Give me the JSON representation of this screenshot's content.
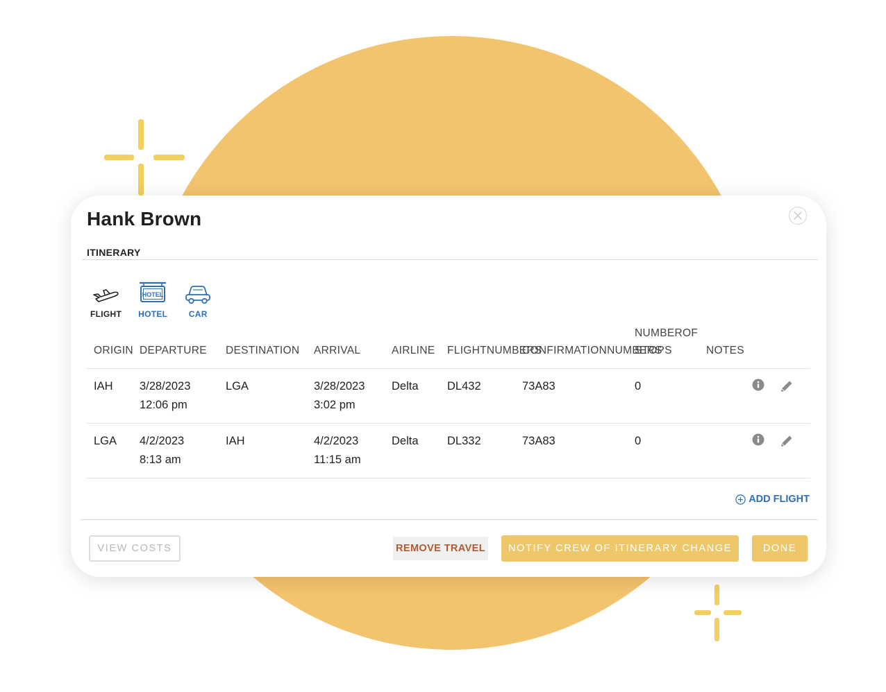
{
  "modal": {
    "title": "Hank Brown",
    "close_icon": "close-circle-icon"
  },
  "section_label": "ITINERARY",
  "tabs": [
    {
      "label": "FLIGHT",
      "icon": "plane-icon",
      "color": "#222222"
    },
    {
      "label": "HOTEL",
      "icon": "hotel-sign-icon",
      "color": "#2f6fb3"
    },
    {
      "label": "CAR",
      "icon": "car-icon",
      "color": "#2f6fb3"
    }
  ],
  "table": {
    "headers": {
      "origin": [
        "ORIGIN"
      ],
      "departure": [
        "DEPARTURE"
      ],
      "destination": [
        "DESTINATION"
      ],
      "arrival": [
        "ARRIVAL"
      ],
      "airline": [
        "AIRLINE"
      ],
      "flight_numbers": [
        "FLIGHT",
        "NUMBERS"
      ],
      "confirmation_numbers": [
        "CONFIRMATION",
        "NUMBERS"
      ],
      "number_of_stops": [
        "NUMBER",
        "OF STOPS"
      ],
      "notes": [
        "NOTES"
      ]
    },
    "rows": [
      {
        "origin": "IAH",
        "departure_date": "3/28/2023",
        "departure_time": "12:06 pm",
        "destination": "LGA",
        "arrival_date": "3/28/2023",
        "arrival_time": "3:02 pm",
        "airline": "Delta",
        "flight_number": "DL432",
        "confirmation_number": "73A83",
        "stops": "0",
        "notes": ""
      },
      {
        "origin": "LGA",
        "departure_date": "4/2/2023",
        "departure_time": "8:13 am",
        "destination": "IAH",
        "arrival_date": "4/2/2023",
        "arrival_time": "11:15 am",
        "airline": "Delta",
        "flight_number": "DL332",
        "confirmation_number": "73A83",
        "stops": "0",
        "notes": ""
      }
    ],
    "row_icons": [
      "info-icon",
      "pencil-edit-icon"
    ]
  },
  "add_flight_label": "ADD FLIGHT",
  "footer": {
    "view_costs": "VIEW COSTS",
    "remove_travel": "REMOVE TRAVEL",
    "notify_crew": "NOTIFY CREW OF ITINERARY CHANGE",
    "done": "DONE"
  },
  "colors": {
    "accent_yellow": "#eec76b",
    "background_circle": "#f3c46e",
    "link_blue": "#2f6fb3",
    "remove_text": "#b35a32"
  }
}
